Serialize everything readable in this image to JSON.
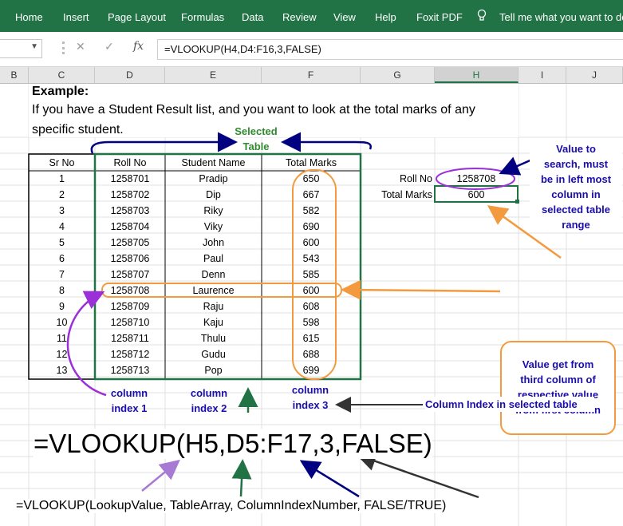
{
  "ribbon": {
    "tabs": [
      "Home",
      "Insert",
      "Page Layout",
      "Formulas",
      "Data",
      "Review",
      "View",
      "Help",
      "Foxit PDF"
    ],
    "tell_me": "Tell me what you want to do"
  },
  "formula_bar": {
    "cancel_icon": "x-icon",
    "enter_icon": "check-icon",
    "fx_label": "fx",
    "formula": "=VLOOKUP(H4,D4:F16,3,FALSE)"
  },
  "columns": [
    "B",
    "C",
    "D",
    "E",
    "F",
    "G",
    "H",
    "I",
    "J"
  ],
  "selected_column": "H",
  "example": {
    "heading": "Example:",
    "line1": "If you have a Student Result list, and you want to look at the total marks of any",
    "line2": "specific student."
  },
  "selected_table_label": [
    "Selected",
    "Table"
  ],
  "table": {
    "headers": [
      "Sr No",
      "Roll No",
      "Student Name",
      "Total Marks"
    ],
    "rows": [
      [
        "1",
        "1258701",
        "Pradip",
        "650"
      ],
      [
        "2",
        "1258702",
        "Dip",
        "667"
      ],
      [
        "3",
        "1258703",
        "Riky",
        "582"
      ],
      [
        "4",
        "1258704",
        "Viky",
        "690"
      ],
      [
        "5",
        "1258705",
        "John",
        "600"
      ],
      [
        "6",
        "1258706",
        "Paul",
        "543"
      ],
      [
        "7",
        "1258707",
        "Denn",
        "585"
      ],
      [
        "8",
        "1258708",
        "Laurence",
        "600"
      ],
      [
        "9",
        "1258709",
        "Raju",
        "608"
      ],
      [
        "10",
        "1258710",
        "Kaju",
        "598"
      ],
      [
        "11",
        "1258711",
        "Thulu",
        "615"
      ],
      [
        "12",
        "1258712",
        "Gudu",
        "688"
      ],
      [
        "13",
        "1258713",
        "Pop",
        "699"
      ]
    ]
  },
  "lookup": {
    "roll_label": "Roll No",
    "roll_value": "1258708",
    "marks_label": "Total Marks",
    "marks_value": "600"
  },
  "notes": {
    "value_to_search": [
      "Value to",
      "search, must",
      "be in left most",
      "column in",
      "selected table",
      "range"
    ],
    "value_get_from": [
      "Value get from",
      "third column of",
      "respective value",
      "from first column"
    ],
    "col_index1": [
      "column",
      "index 1"
    ],
    "col_index2": [
      "column",
      "index 2"
    ],
    "col_index3": [
      "column",
      "index 3"
    ],
    "col_index_desc": "Column Index in selected table"
  },
  "big_formula": "=VLOOKUP(H5,D5:F17,3,FALSE)",
  "syntax": "=VLOOKUP(LookupValue, TableArray, ColumnIndexNumber, FALSE/TRUE)",
  "colors": {
    "ribbon": "#217346",
    "navy": "#000080",
    "green": "#217346",
    "orange": "#f39a3e",
    "purple": "#9b30d9",
    "label_blue": "#1a0dab"
  }
}
